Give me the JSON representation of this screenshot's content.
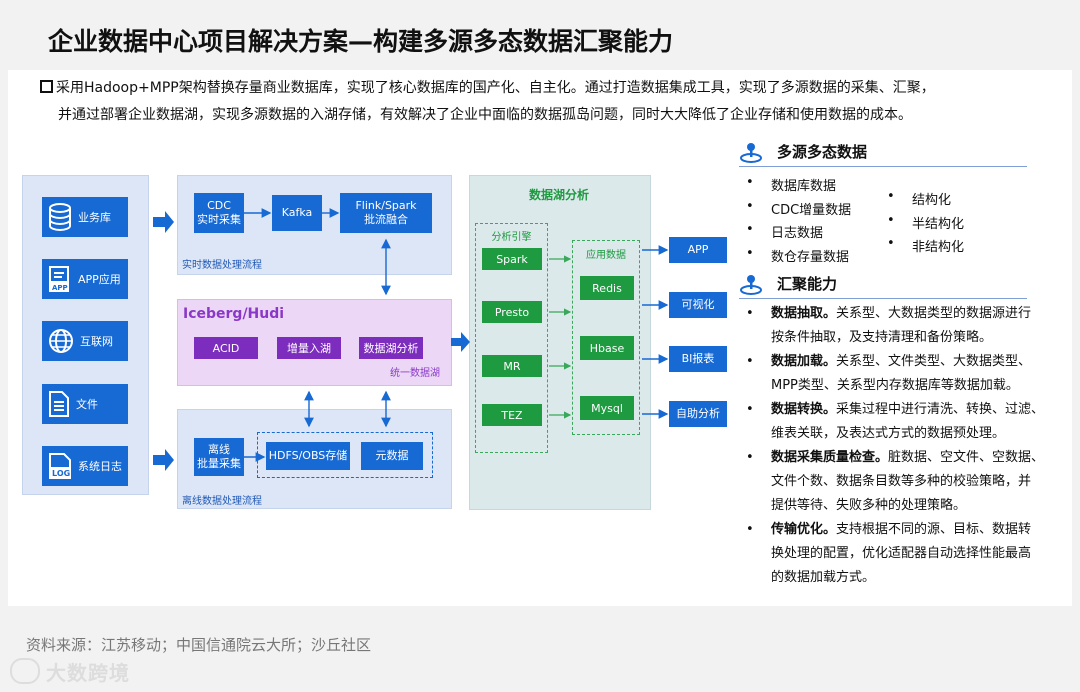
{
  "title": "企业数据中心项目解决方案—构建多源多态数据汇聚能力",
  "intro": {
    "line1": "采用Hadoop+MPP架构替换存量商业数据库，实现了核心数据库的国产化、自主化。通过打造数据集成工具，实现了多源数据的采集、汇聚，",
    "line2": "并通过部署企业数据湖，实现多源数据的入湖存储，有效解决了企业中面临的数据孤岛问题，同时大大降低了企业存储和使用数据的成本。"
  },
  "sources": [
    {
      "label": "业务库",
      "icon": "database-icon"
    },
    {
      "label": "APP应用",
      "icon": "app-icon"
    },
    {
      "label": "互联网",
      "icon": "globe-icon"
    },
    {
      "label": "文件",
      "icon": "document-icon"
    },
    {
      "label": "系统日志",
      "icon": "log-icon"
    }
  ],
  "realtime": {
    "cdc": "CDC\n实时采集",
    "kafka": "Kafka",
    "flink": "Flink/Spark\n批流融合",
    "caption": "实时数据处理流程"
  },
  "lake": {
    "name": "Iceberg/Hudi",
    "items": [
      "ACID",
      "增量入湖",
      "数据湖分析"
    ],
    "caption": "统一数据湖"
  },
  "offline": {
    "batch": "离线\n批量采集",
    "hdfs": "HDFS/OBS存储",
    "meta": "元数据",
    "caption": "离线数据处理流程"
  },
  "analysis": {
    "title": "数据湖分析",
    "engine_label": "分析引擎",
    "engines": [
      "Spark",
      "Presto",
      "MR",
      "TEZ"
    ],
    "app_label": "应用数据",
    "apps": [
      "Redis",
      "Hbase",
      "Mysql"
    ]
  },
  "outputs": [
    "APP",
    "可视化",
    "BI报表",
    "自助分析"
  ],
  "multi_source": {
    "heading": "多源多态数据",
    "left": [
      "数据库数据",
      "CDC增量数据",
      "日志数据",
      "数仓存量数据"
    ],
    "right": [
      "结构化",
      "半结构化",
      "非结构化"
    ]
  },
  "convergence": {
    "heading": "汇聚能力",
    "items": [
      {
        "bold": "数据抽取。",
        "lines": [
          "关系型、大数据类型的数据源进行",
          "按条件抽取，及支持清理和备份策略。"
        ]
      },
      {
        "bold": "数据加载。",
        "lines": [
          "关系型、文件类型、大数据类型、",
          "MPP类型、关系型内存数据库等数据加载。"
        ]
      },
      {
        "bold": "数据转换。",
        "lines": [
          "采集过程中进行清洗、转换、过滤、",
          "维表关联，及表达式方式的数据预处理。"
        ]
      },
      {
        "bold": "数据采集质量检查。",
        "lines": [
          "脏数据、空文件、空数据、",
          "文件个数、数据条目数等多种的校验策略，并",
          "提供等待、失败多种的处理策略。"
        ]
      },
      {
        "bold": "传输优化。",
        "lines": [
          "支持根据不同的源、目标、数据转",
          "换处理的配置，优化适配器自动选择性能最高",
          "的数据加载方式。"
        ]
      }
    ]
  },
  "footer": "资料来源：江苏移动；中国信通院云大所；沙丘社区",
  "watermark": "大数跨境"
}
